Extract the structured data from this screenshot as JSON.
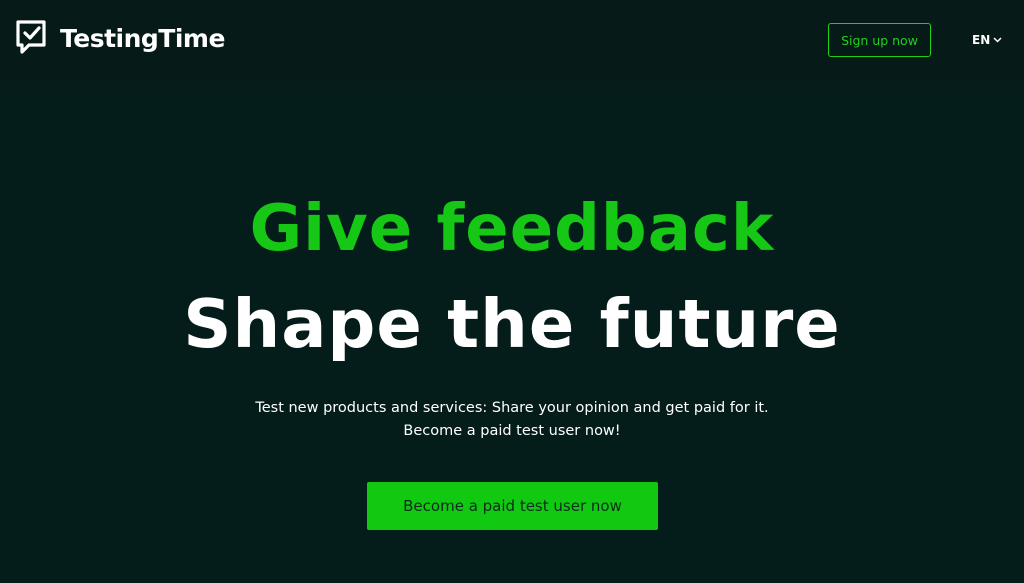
{
  "header": {
    "logo_text": "TestingTime",
    "signup_label": "Sign up now",
    "language": "EN"
  },
  "hero": {
    "headline_green": "Give feedback",
    "headline_white": "Shape the future",
    "subtitle_line1": "Test new products and services: Share your opinion and get paid for it.",
    "subtitle_line2": "Become a paid test user now!",
    "cta_label": "Become a paid test user now"
  },
  "colors": {
    "background": "#041c1a",
    "accent_green": "#16c716",
    "text_white": "#ffffff"
  },
  "icons": {
    "logo": "chat-check-icon",
    "language": "chevron-down-icon"
  }
}
